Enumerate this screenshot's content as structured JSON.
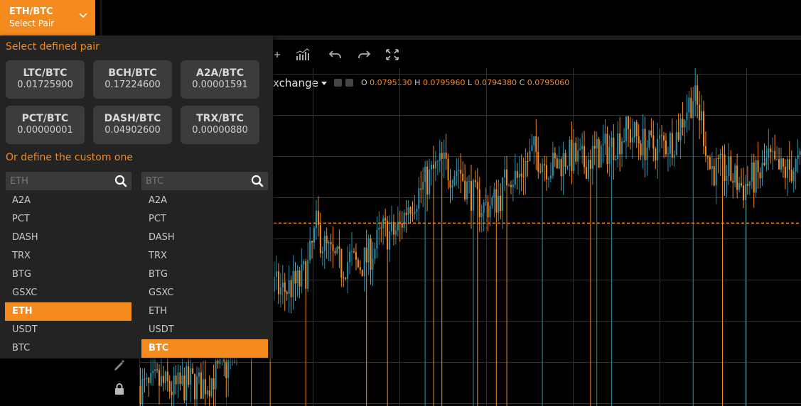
{
  "pair_selector": {
    "title": "ETH/BTC",
    "subtitle": "Select Pair"
  },
  "chart_header": {
    "exchange": "xchange",
    "ohlc": {
      "o_label": "O",
      "o": "0.0795130",
      "h_label": "H",
      "h": "0.0795960",
      "l_label": "L",
      "l": "0.0794380",
      "c_label": "C",
      "c": "0.0795060"
    }
  },
  "dropdown": {
    "defined_heading": "Select defined pair",
    "defined_pairs": [
      {
        "name": "LTC/BTC",
        "value": "0.01725900"
      },
      {
        "name": "BCH/BTC",
        "value": "0.17224600"
      },
      {
        "name": "A2A/BTC",
        "value": "0.00001591"
      },
      {
        "name": "PCT/BTC",
        "value": "0.00000001"
      },
      {
        "name": "DASH/BTC",
        "value": "0.04902600"
      },
      {
        "name": "TRX/BTC",
        "value": "0.00000880"
      }
    ],
    "custom_heading": "Or define the custom one",
    "base": {
      "placeholder": "ETH",
      "items": [
        "A2A",
        "PCT",
        "DASH",
        "TRX",
        "BTG",
        "GSXC",
        "ETH",
        "USDT",
        "BTC"
      ],
      "selected": "ETH"
    },
    "quote": {
      "placeholder": "BTC",
      "items": [
        "A2A",
        "PCT",
        "DASH",
        "TRX",
        "BTG",
        "GSXC",
        "ETH",
        "USDT",
        "BTC"
      ],
      "selected": "BTC"
    }
  },
  "colors": {
    "accent": "#f58a1f",
    "bull": "#2a8fa8",
    "bear": "#f58a1f",
    "grid": "#333333",
    "panel": "#232323"
  },
  "chart_data": {
    "type": "candlestick",
    "title": "",
    "xlabel": "",
    "ylabel": "",
    "series": [
      {
        "values": [
          0.0745,
          0.0744,
          0.0746,
          0.0745,
          0.0744,
          0.0745,
          0.0746,
          0.0745,
          0.0746,
          0.0748,
          0.0749,
          0.0752,
          0.0762,
          0.0772,
          0.077,
          0.0768,
          0.077,
          0.0769,
          0.077,
          0.0771,
          0.0775,
          0.0785,
          0.078,
          0.0777,
          0.0775,
          0.0777,
          0.0775,
          0.0777,
          0.078,
          0.0784,
          0.0783,
          0.0785,
          0.0791,
          0.0793,
          0.0796,
          0.0799,
          0.0801,
          0.0799,
          0.08,
          0.0795,
          0.0792,
          0.079,
          0.0791,
          0.0793,
          0.0799,
          0.0797,
          0.0801,
          0.0804,
          0.0802,
          0.08,
          0.0801,
          0.0803,
          0.0802,
          0.0801,
          0.0803,
          0.0804,
          0.0805,
          0.0807,
          0.0809,
          0.0808,
          0.0806,
          0.0805,
          0.0806,
          0.0806,
          0.0808,
          0.0814,
          0.0818,
          0.0812,
          0.08,
          0.0799,
          0.0799,
          0.0797,
          0.0795,
          0.0797,
          0.0798,
          0.0802,
          0.0799,
          0.0799,
          0.08,
          0.0801
        ]
      }
    ]
  }
}
